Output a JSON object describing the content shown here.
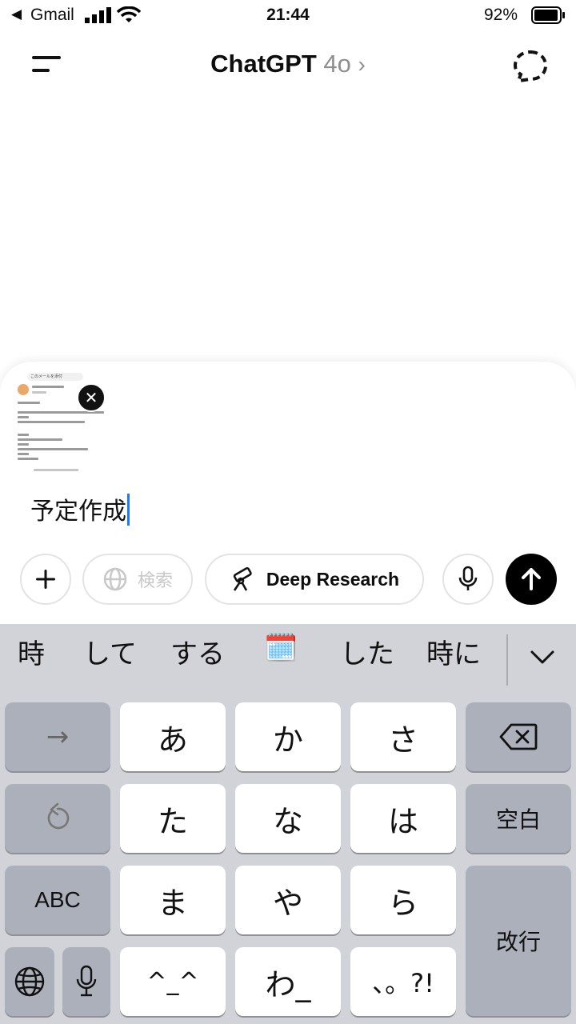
{
  "status_bar": {
    "back_app": "Gmail",
    "time": "21:44",
    "battery": "92%"
  },
  "header": {
    "title": "ChatGPT",
    "model": "4o",
    "chevron": "›"
  },
  "composer": {
    "attachment_label": "このメールを添付",
    "input_value": "予定作成",
    "search_label": "検索",
    "deep_research_label": "Deep Research"
  },
  "keyboard": {
    "suggestions": [
      "時",
      "して",
      "する",
      "した",
      "時に"
    ],
    "suggestion_emoji": "🗓️",
    "keys": {
      "arrow": "→",
      "a": "あ",
      "ka": "か",
      "sa": "さ",
      "ta": "た",
      "na": "な",
      "ha": "は",
      "space": "空白",
      "abc": "ABC",
      "ma": "ま",
      "ya": "や",
      "ra": "ら",
      "return": "改行",
      "kaomoji": "^_^",
      "wa": "わ_",
      "punct": "、。?!"
    }
  },
  "colors": {
    "caret": "#1a7cf5",
    "keyboard_bg": "#d1d3d9",
    "function_key": "#abb0bb"
  }
}
